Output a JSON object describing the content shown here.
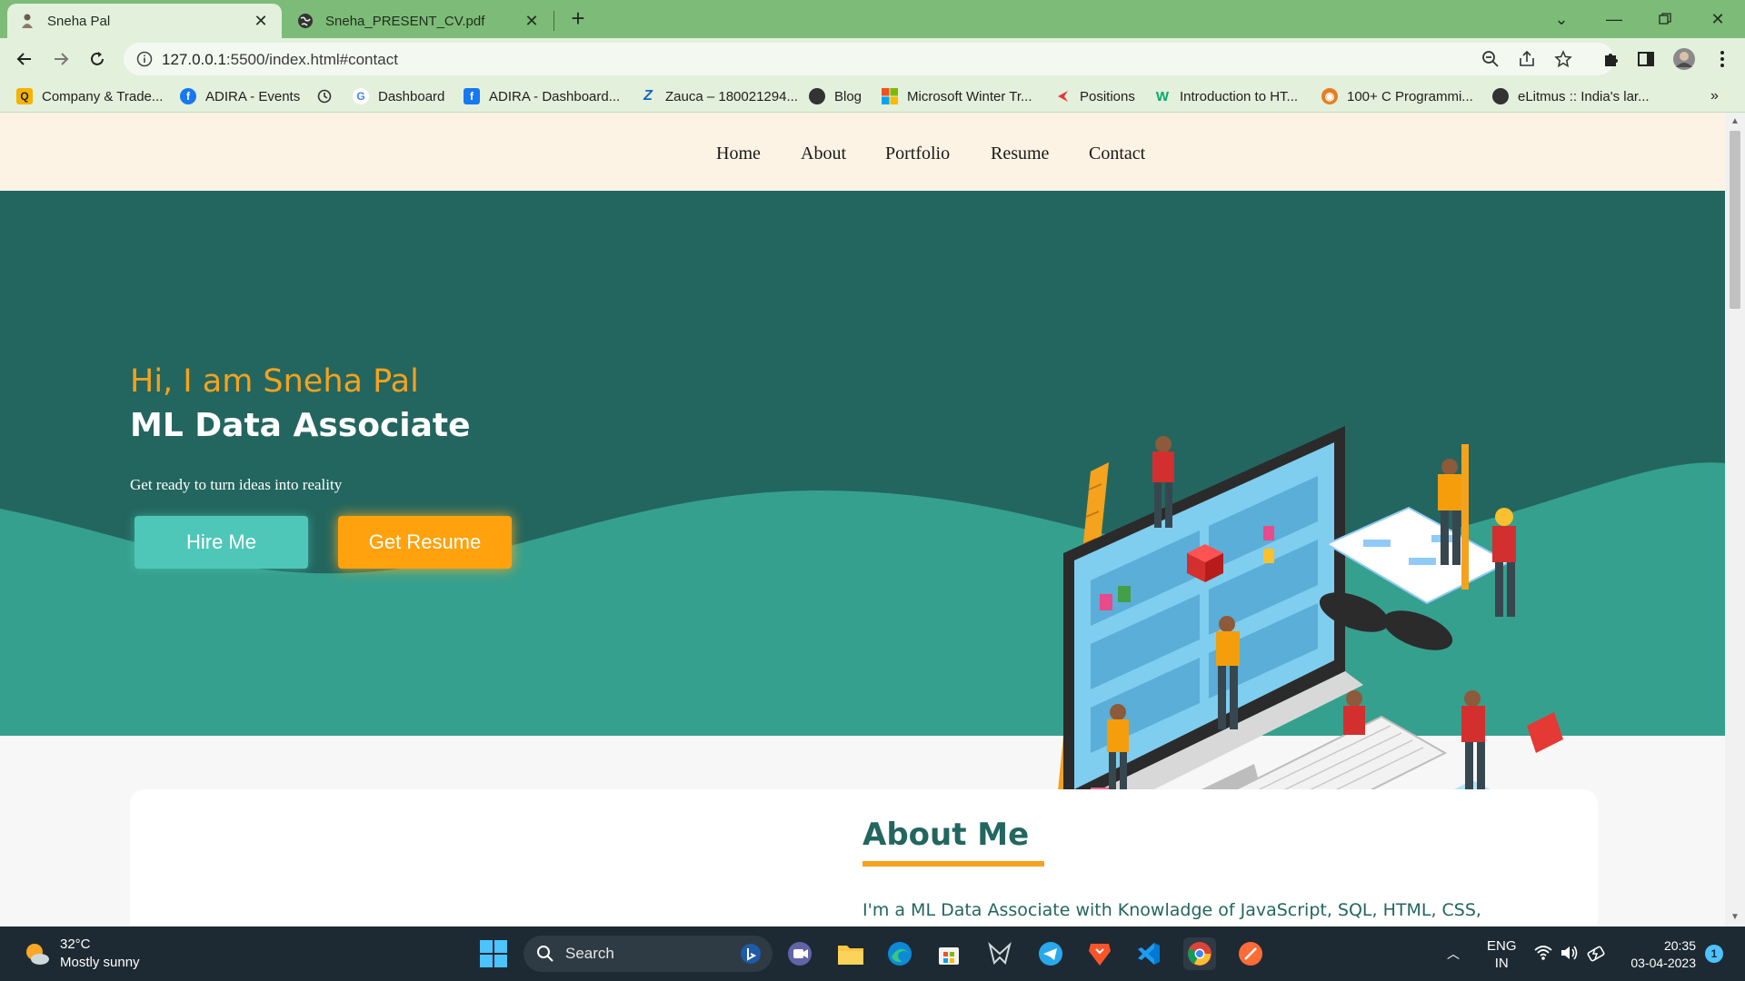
{
  "browser": {
    "tabs": [
      {
        "title": "Sneha Pal",
        "active": true
      },
      {
        "title": "Sneha_PRESENT_CV.pdf",
        "active": false
      }
    ],
    "url_host": "127.0.0.1",
    "url_path": ":5500/index.html#contact",
    "bookmarks": [
      {
        "label": "Company & Trade...",
        "icon": "q-icon",
        "color": "#f5b400"
      },
      {
        "label": "ADIRA - Events",
        "icon": "facebook-icon",
        "color": "#1877f2"
      },
      {
        "label": "",
        "icon": "history-icon",
        "color": "#444444"
      },
      {
        "label": "Dashboard",
        "icon": "google-icon",
        "color": "#4285f4"
      },
      {
        "label": "ADIRA - Dashboard...",
        "icon": "facebook-icon",
        "color": "#1877f2"
      },
      {
        "label": "Zauca – 180021294...",
        "icon": "zauca-icon",
        "color": "#1565c0"
      },
      {
        "label": "Blog",
        "icon": "globe-icon",
        "color": "#333333"
      },
      {
        "label": "Microsoft Winter Tr...",
        "icon": "microsoft-icon",
        "color": "#f25022"
      },
      {
        "label": "Positions",
        "icon": "positions-icon",
        "color": "#e53935"
      },
      {
        "label": "Introduction to HT...",
        "icon": "w3schools-icon",
        "color": "#04aa6d"
      },
      {
        "label": "100+ C Programmi...",
        "icon": "programmi-icon",
        "color": "#e67e22"
      },
      {
        "label": "eLitmus :: India's lar...",
        "icon": "globe-icon",
        "color": "#333333"
      }
    ]
  },
  "site": {
    "nav": [
      "Home",
      "About",
      "Portfolio",
      "Resume",
      "Contact"
    ],
    "hero": {
      "greeting": "Hi, I am Sneha Pal",
      "role": "ML Data Associate",
      "tagline": "Get ready to turn ideas into reality",
      "hire_label": "Hire Me",
      "resume_label": "Get Resume"
    },
    "about": {
      "title": "About Me",
      "text": "I'm a ML Data Associate with Knowladge of JavaScript, SQL, HTML, CSS,"
    }
  },
  "taskbar": {
    "temperature": "32°C",
    "weather": "Mostly sunny",
    "search_label": "Search",
    "lang": "ENG",
    "region": "IN",
    "time": "20:35",
    "date": "03-04-2023",
    "notification_count": "1"
  },
  "colors": {
    "hero_dark": "#23665f",
    "hero_wave": "#36a08e",
    "accent_orange": "#f5a21e",
    "button_teal": "#4fc7b8",
    "nav_bg": "#fdf3e4",
    "chrome_green": "#7dbb78"
  }
}
